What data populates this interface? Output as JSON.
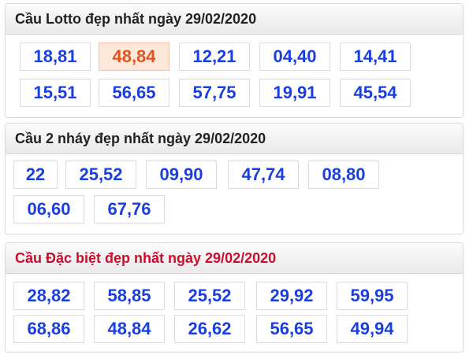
{
  "sections": [
    {
      "title": "Cầu Lotto đẹp nhất ngày 29/02/2020",
      "highlight_index": 1,
      "pairs": [
        "18,81",
        "48,84",
        "12,21",
        "04,40",
        "14,41",
        "15,51",
        "56,65",
        "57,75",
        "19,91",
        "45,54"
      ]
    },
    {
      "title": "Cầu 2 nháy đẹp nhất ngày 29/02/2020",
      "pairs": [
        "22",
        "25,52",
        "09,90",
        "47,74",
        "08,80",
        "06,60",
        "67,76"
      ]
    },
    {
      "title": "Cầu Đặc biệt đẹp nhất ngày 29/02/2020",
      "pairs": [
        "28,82",
        "58,85",
        "25,52",
        "29,92",
        "59,95",
        "68,86",
        "48,84",
        "26,62",
        "56,65",
        "49,94"
      ]
    }
  ],
  "colors": {
    "number": "#1a3fe0",
    "highlight_text": "#e2541f",
    "highlight_bg": "#fde7d9",
    "special_title": "#c8102e"
  }
}
